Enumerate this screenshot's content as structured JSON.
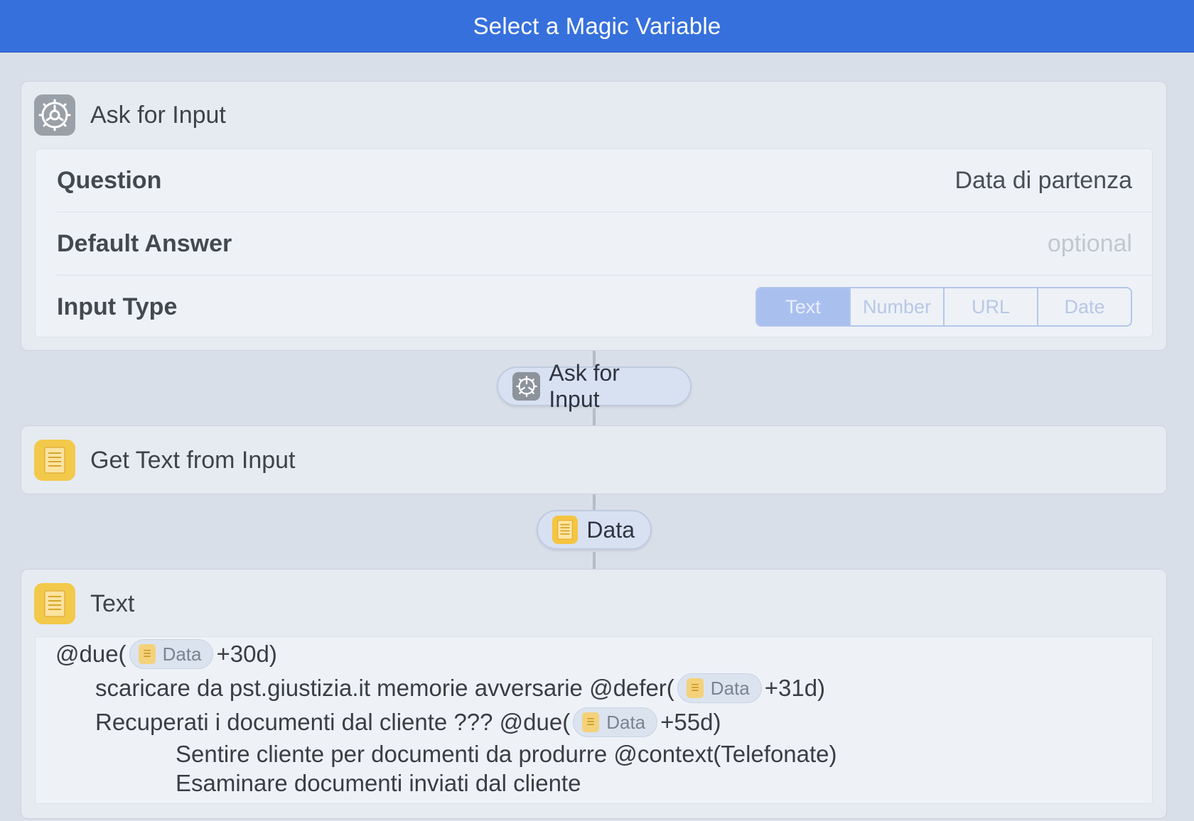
{
  "header": {
    "title": "Select a Magic Variable"
  },
  "ask_for_input_card": {
    "title": "Ask for Input",
    "icon": "gear-icon",
    "question_label": "Question",
    "question_value": "Data di partenza",
    "default_answer_label": "Default Answer",
    "default_answer_placeholder": "optional",
    "input_type_label": "Input Type",
    "input_types": [
      "Text",
      "Number",
      "URL",
      "Date"
    ],
    "selected_input_type": "Text"
  },
  "variable_ask": {
    "label": "Ask for Input",
    "icon": "gear-icon"
  },
  "get_text_card": {
    "title": "Get Text from Input",
    "icon": "text-document-icon"
  },
  "variable_data": {
    "label": "Data",
    "icon": "text-document-icon"
  },
  "text_card": {
    "title": "Text",
    "icon": "text-document-icon",
    "chip_label": "Data",
    "lines": [
      {
        "before": "@due(",
        "after": " +30d)"
      },
      {
        "before": "scaricare da pst.giustizia.it  memorie avversarie @defer(",
        "after": "+31d)"
      },
      {
        "before": "Recuperati i documenti dal cliente ??? @due(",
        "after": " +55d)"
      },
      {
        "text": "Sentire cliente per documenti da produrre @context(Telefonate)"
      },
      {
        "text": "Esaminare documenti inviati dal cliente"
      }
    ]
  },
  "colors": {
    "title_bar": "#3670dc",
    "background": "#d9dfe8",
    "selected_segment": "#a9c0ef"
  }
}
